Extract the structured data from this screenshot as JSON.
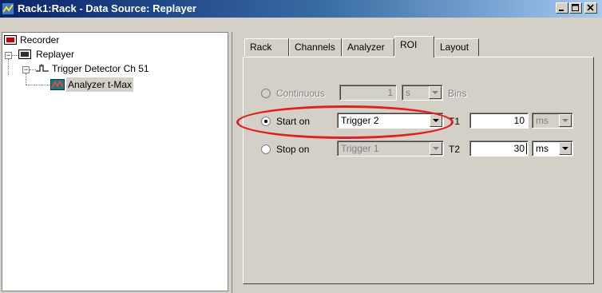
{
  "window": {
    "title": "Rack1:Rack - Data Source: Replayer"
  },
  "tree": {
    "items": [
      {
        "label": "Recorder"
      },
      {
        "label": "Replayer"
      },
      {
        "label": "Trigger Detector Ch 51"
      },
      {
        "label": "Analyzer t-Max"
      }
    ]
  },
  "tabs": [
    "Rack",
    "Channels",
    "Analyzer",
    "ROI",
    "Layout"
  ],
  "active_tab": "ROI",
  "roi": {
    "continuous": {
      "label": "Continuous",
      "value": "1",
      "unit": "s",
      "suffix": "Bins"
    },
    "start_on": {
      "label": "Start on",
      "trigger": "Trigger 2",
      "t_label": "T1",
      "t_value": "10",
      "t_unit": "ms"
    },
    "stop_on": {
      "label": "Stop on",
      "trigger": "Trigger 1",
      "t_label": "T2",
      "t_value": "30",
      "t_unit": "ms"
    }
  },
  "colors": {
    "highlight_ellipse": "#e0201e",
    "titlebar": "#0a246a"
  }
}
